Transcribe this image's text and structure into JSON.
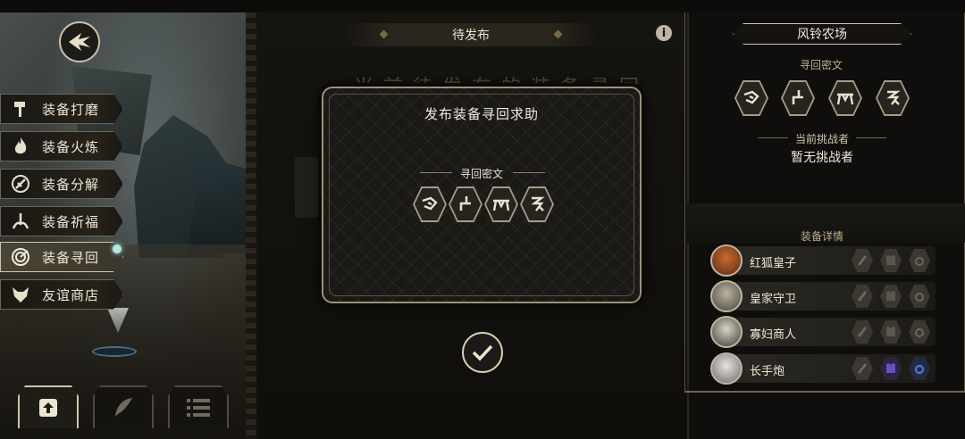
{
  "left_menu": {
    "items": [
      {
        "label": "装备打磨",
        "icon": "hammer-icon"
      },
      {
        "label": "装备火炼",
        "icon": "flame-icon"
      },
      {
        "label": "装备分解",
        "icon": "disassemble-icon"
      },
      {
        "label": "装备祈福",
        "icon": "blessing-icon"
      },
      {
        "label": "装备寻回",
        "icon": "target-icon",
        "active": true
      },
      {
        "label": "友谊商店",
        "icon": "fox-icon"
      }
    ],
    "bottom_buttons": [
      "upload-icon",
      "feather-icon",
      "list-icon"
    ]
  },
  "center": {
    "header": "待发布",
    "background_title": "当 前 待 发 布 的 装 备 寻 回",
    "info": "i"
  },
  "modal": {
    "title": "发布装备寻回求助",
    "runes_label": "寻回密文",
    "runes": [
      "rune-1-icon",
      "rune-2-icon",
      "rune-3-icon",
      "rune-4-icon"
    ]
  },
  "right": {
    "farm_name": "风铃农场",
    "runes_label": "寻回密文",
    "challenger_label": "当前挑战者",
    "challenger_value": "暂无挑战者",
    "details_label": "装备详情",
    "heroes": [
      {
        "name": "红狐皇子",
        "slots": [
          "weapon",
          "armor",
          "ring"
        ]
      },
      {
        "name": "皇家守卫",
        "slots": [
          "weapon",
          "armor",
          "ring"
        ]
      },
      {
        "name": "寡妇商人",
        "slots": [
          "weapon",
          "armor",
          "ring"
        ]
      },
      {
        "name": "长手炮",
        "slots": [
          "weapon",
          "armor-purple",
          "ring-blue"
        ]
      }
    ]
  },
  "colors": {
    "accent": "#d9cfb3",
    "gold_label": "#bdb08c",
    "active_dot": "#b7e6e2",
    "rare_purple": "#6b4fb8",
    "rare_blue": "#3a5fb8"
  }
}
